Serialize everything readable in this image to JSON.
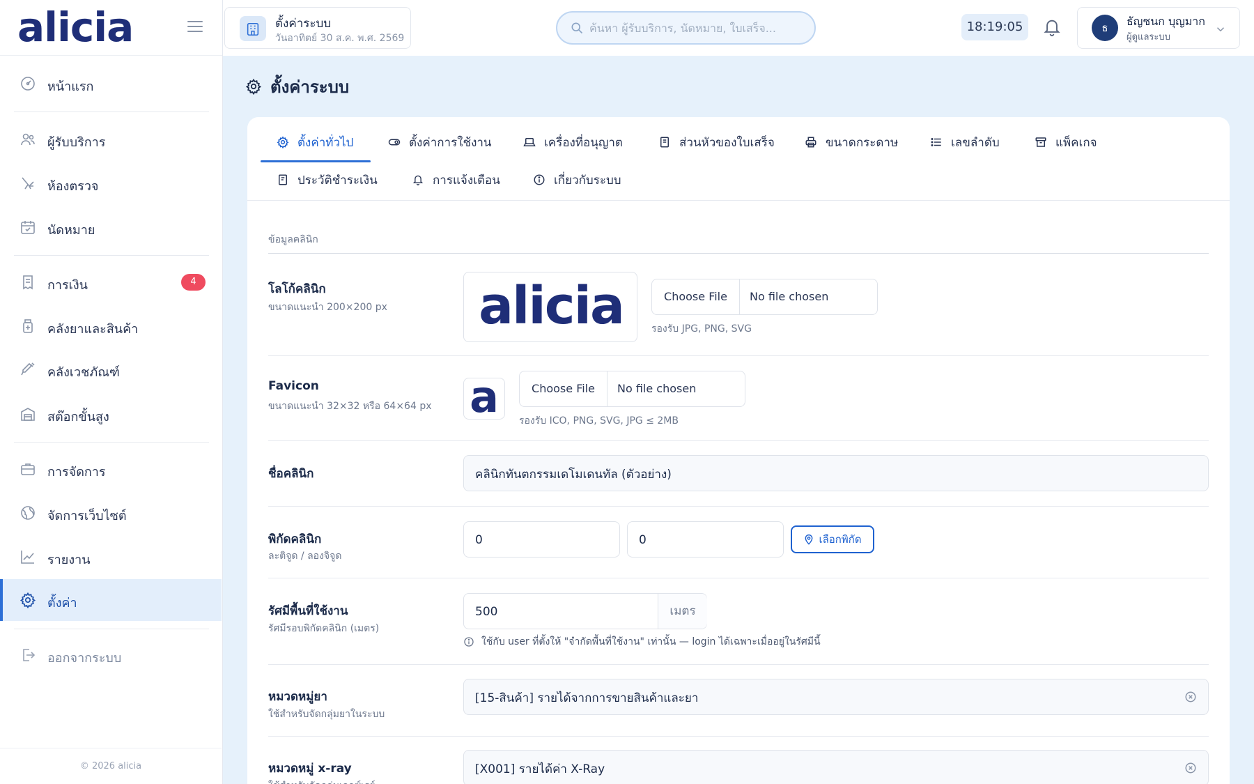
{
  "brand": {
    "name": "alicia"
  },
  "header": {
    "page_chip_title": "ตั้งค่าระบบ",
    "page_chip_date": "วันอาทิตย์ 30 ส.ค. พ.ศ. 2569",
    "search_placeholder": "ค้นหา ผู้รับบริการ, นัดหมาย, ใบเสร็จ...",
    "clock": "18:19:05",
    "user_initial": "ธ",
    "user_name": "ธัญชนก บุญมาก",
    "user_role": "ผู้ดูแลระบบ"
  },
  "sidebar": {
    "items": [
      {
        "label": "หน้าแรก",
        "icon": "dashboard-icon"
      },
      {
        "label": "ผู้รับบริการ",
        "icon": "users-icon"
      },
      {
        "label": "ห้องตรวจ",
        "icon": "dental-chair-icon"
      },
      {
        "label": "นัดหมาย",
        "icon": "calendar-icon"
      },
      {
        "label": "การเงิน",
        "icon": "receipt-icon",
        "badge": "4"
      },
      {
        "label": "คลังยาและสินค้า",
        "icon": "medicine-icon"
      },
      {
        "label": "คลังเวชภัณฑ์",
        "icon": "syringe-icon"
      },
      {
        "label": "สต๊อกขั้นสูง",
        "icon": "warehouse-icon"
      },
      {
        "label": "การจัดการ",
        "icon": "briefcase-icon"
      },
      {
        "label": "จัดการเว็บไซต์",
        "icon": "globe-icon"
      },
      {
        "label": "รายงาน",
        "icon": "chart-icon"
      },
      {
        "label": "ตั้งค่า",
        "icon": "gear-icon",
        "active": true
      },
      {
        "label": "ออกจากระบบ",
        "icon": "logout-icon"
      }
    ],
    "footer": "© 2026 alicia"
  },
  "main": {
    "title": "ตั้งค่าระบบ",
    "tabs": [
      {
        "label": "ตั้งค่าทั่วไป",
        "icon": "gear-icon",
        "active": true
      },
      {
        "label": "ตั้งค่าการใช้งาน",
        "icon": "toggle-icon"
      },
      {
        "label": "เครื่องที่อนุญาต",
        "icon": "laptop-icon"
      },
      {
        "label": "ส่วนหัวของใบเสร็จ",
        "icon": "document-icon"
      },
      {
        "label": "ขนาดกระดาษ",
        "icon": "printer-icon"
      },
      {
        "label": "เลขลำดับ",
        "icon": "list-icon"
      },
      {
        "label": "แพ็คเกจ",
        "icon": "package-icon"
      },
      {
        "label": "ประวัติชำระเงิน",
        "icon": "receipt-icon"
      },
      {
        "label": "การแจ้งเตือน",
        "icon": "bell-icon"
      },
      {
        "label": "เกี่ยวกับระบบ",
        "icon": "info-icon"
      }
    ],
    "section_heading": "ข้อมูลคลินิก",
    "fields": {
      "logo": {
        "label": "โลโก้คลินิก",
        "hint": "ขนาดแนะนำ 200×200 px",
        "preview_text": "alicia",
        "button": "Choose File",
        "status": "No file chosen",
        "note": "รองรับ JPG, PNG, SVG"
      },
      "favicon": {
        "label": "Favicon",
        "hint": "ขนาดแนะนำ 32×32 หรือ 64×64 px",
        "preview_text": "a",
        "button": "Choose File",
        "status": "No file chosen",
        "note": "รองรับ ICO, PNG, SVG, JPG ≤ 2MB"
      },
      "clinic_name": {
        "label": "ชื่อคลินิก",
        "value": "คลินิกทันตกรรมเดโมเดนทัล (ตัวอย่าง)"
      },
      "coordinates": {
        "label": "พิกัดคลินิก",
        "hint": "ละติจูด / ลองจิจูด",
        "latitude": "0",
        "longitude": "0",
        "pick_button": "เลือกพิกัด"
      },
      "radius": {
        "label": "รัศมีพื้นที่ใช้งาน",
        "hint": "รัศมีรอบพิกัดคลินิก (เมตร)",
        "value": "500",
        "unit": "เมตร",
        "note": "ใช้กับ user ที่ตั้งให้ \"จำกัดพื้นที่ใช้งาน\" เท่านั้น — login ได้เฉพาะเมื่ออยู่ในรัศมีนี้"
      },
      "drug_category": {
        "label": "หมวดหมู่ยา",
        "hint": "ใช้สำหรับจัดกลุ่มยาในระบบ",
        "value": "[15-สินค้า] รายได้จากการขายสินค้าและยา"
      },
      "xray_category": {
        "label": "หมวดหมู่ x-ray",
        "hint": "ใช้สำหรับจัดกลุ่มเอกซ์เรย์",
        "value": "[X001] รายได้ค่า X-Ray"
      }
    }
  },
  "colors": {
    "brand": "#1f2e78",
    "accent": "#2d6fd6",
    "badge": "#ef4b5f",
    "background": "#e6f1fb"
  }
}
